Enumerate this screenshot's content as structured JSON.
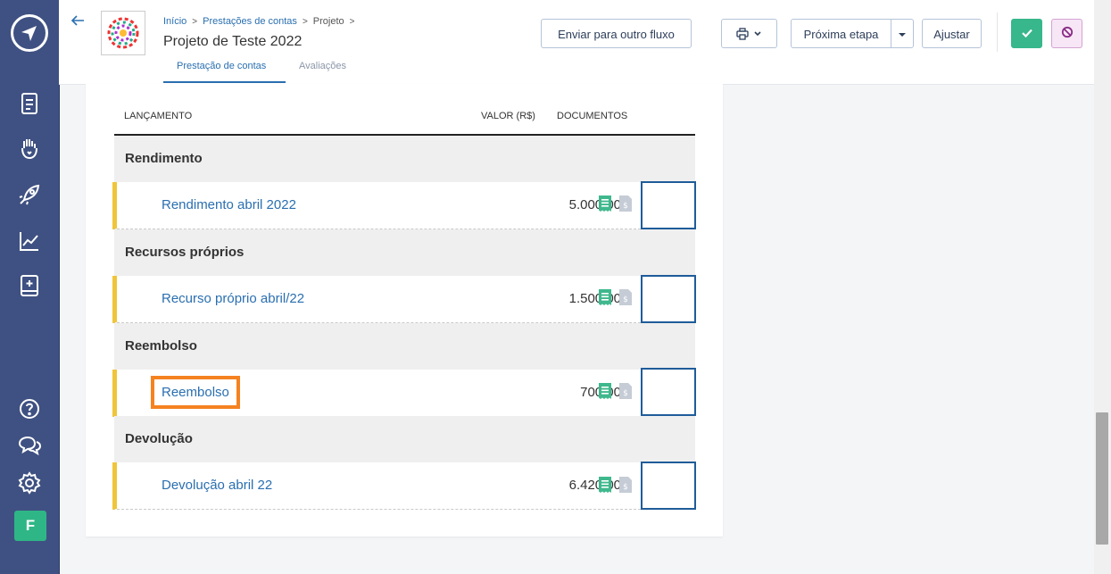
{
  "sidebar": {
    "icons": [
      "document-icon",
      "hand-heart-icon",
      "rocket-icon",
      "chart-line-icon",
      "book-plus-icon"
    ],
    "bottom_icons": [
      "help-icon",
      "chat-icon",
      "gear-icon"
    ],
    "avatar_letter": "F"
  },
  "header": {
    "breadcrumb": [
      "Início",
      "Prestações de contas",
      "Projeto"
    ],
    "title": "Projeto de Teste 2022",
    "tabs": [
      {
        "label": "Prestação de contas",
        "active": true
      },
      {
        "label": "Avaliações",
        "active": false
      }
    ],
    "buttons": {
      "send": "Enviar para outro fluxo",
      "next": "Próxima etapa",
      "adjust": "Ajustar"
    }
  },
  "table": {
    "columns": [
      "LANÇAMENTO",
      "VALOR (R$)",
      "DOCUMENTOS"
    ],
    "groups": [
      {
        "name": "Rendimento",
        "items": [
          {
            "name": "Rendimento abril 2022",
            "value": "5.000,00"
          }
        ]
      },
      {
        "name": "Recursos próprios",
        "items": [
          {
            "name": "Recurso próprio abril/22",
            "value": "1.500,00"
          }
        ]
      },
      {
        "name": "Reembolso",
        "items": [
          {
            "name": "Reembolso",
            "value": "700,00",
            "highlighted": true
          }
        ]
      },
      {
        "name": "Devolução",
        "items": [
          {
            "name": "Devolução abril 22",
            "value": "6.420,00"
          }
        ]
      }
    ]
  },
  "colors": {
    "sidebar": "#3f5182",
    "accent": "#2a6fb0",
    "approve": "#37b78b",
    "row_marker": "#f0c53a",
    "highlight": "#f58220"
  }
}
